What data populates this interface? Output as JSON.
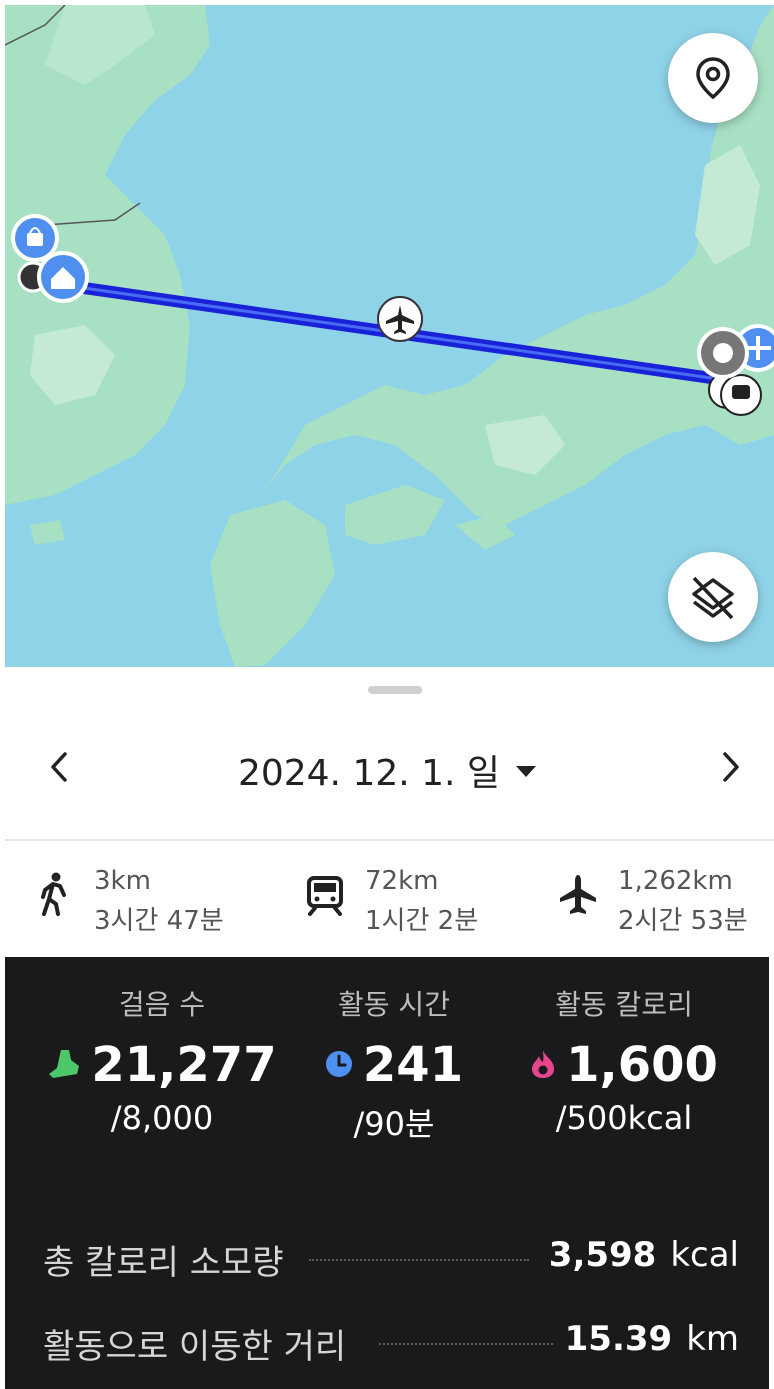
{
  "date": {
    "label": "2024. 12. 1. 일",
    "prev_icon": "chevron-left-icon",
    "next_icon": "chevron-right-icon"
  },
  "map": {
    "locate_icon": "location-pin-icon",
    "layers_icon": "layers-off-icon",
    "route_color": "#1a22d9",
    "water_color": "#8fd3e8",
    "land_color": "#a8e0c4"
  },
  "transport": [
    {
      "icon": "walk-icon",
      "distance": "3km",
      "duration": "3시간 47분"
    },
    {
      "icon": "train-icon",
      "distance": "72km",
      "duration": "1시간 2분"
    },
    {
      "icon": "airplane-icon",
      "distance": "1,262km",
      "duration": "2시간 53분"
    }
  ],
  "stats": {
    "steps": {
      "title": "걸음 수",
      "value": "21,277",
      "goal": "/8,000",
      "icon": "shoe-icon",
      "color": "#4cc86a"
    },
    "active_time": {
      "title": "활동 시간",
      "value": "241",
      "goal": "/90분",
      "icon": "clock-icon",
      "color": "#4f8ff0"
    },
    "active_calories": {
      "title": "활동 칼로리",
      "value": "1,600",
      "goal": "/500kcal",
      "icon": "flame-icon",
      "color": "#e8458f"
    }
  },
  "totals": {
    "calories": {
      "label": "총 칼로리 소모량",
      "value": "3,598",
      "unit": "kcal"
    },
    "distance": {
      "label": "활동으로 이동한 거리",
      "value": "15.39",
      "unit": "km"
    }
  }
}
